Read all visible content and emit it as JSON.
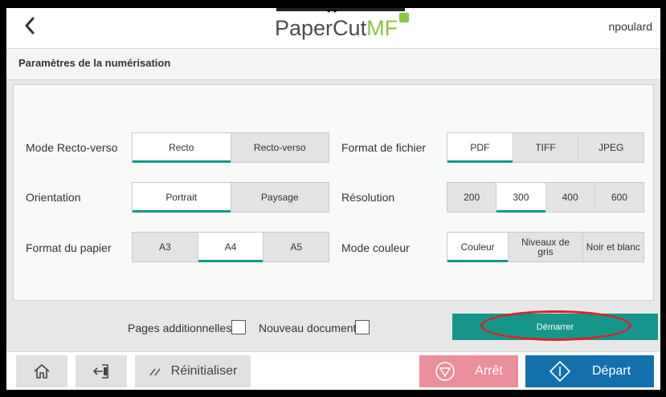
{
  "header": {
    "brand_main": "PaperCut",
    "brand_accent": "MF",
    "username": "npoulard"
  },
  "title": "Paramètres de la numérisation",
  "left_settings": [
    {
      "label": "Mode Recto-verso",
      "options": [
        "Recto",
        "Recto-verso"
      ],
      "selected": 0
    },
    {
      "label": "Orientation",
      "options": [
        "Portrait",
        "Paysage"
      ],
      "selected": 0
    },
    {
      "label": "Format du papier",
      "options": [
        "A3",
        "A4",
        "A5"
      ],
      "selected": 1
    }
  ],
  "right_settings": [
    {
      "label": "Format de fichier",
      "options": [
        "PDF",
        "TIFF",
        "JPEG"
      ],
      "selected": 0
    },
    {
      "label": "Résolution",
      "options": [
        "200",
        "300",
        "400",
        "600"
      ],
      "selected": 1
    },
    {
      "label": "Mode couleur",
      "options": [
        "Couleur",
        "Niveaux de gris",
        "Noir et blanc"
      ],
      "selected": 0
    }
  ],
  "checks": {
    "additional_pages": "Pages additionnelles",
    "new_document": "Nouveau document"
  },
  "start_label": "Démarrer",
  "footer": {
    "reset_label": "Réinitialiser",
    "stop_label": "Arrêt",
    "depart_label": "Départ"
  },
  "colors": {
    "accent": "#16968a",
    "stop": "#ea8f9b",
    "depart": "#1470ad",
    "highlight": "#d8242c",
    "brand_green": "#8cc63f"
  },
  "icons": [
    "back-arrow-icon",
    "home-icon",
    "logout-icon",
    "reset-icon",
    "stop-icon",
    "depart-icon"
  ]
}
